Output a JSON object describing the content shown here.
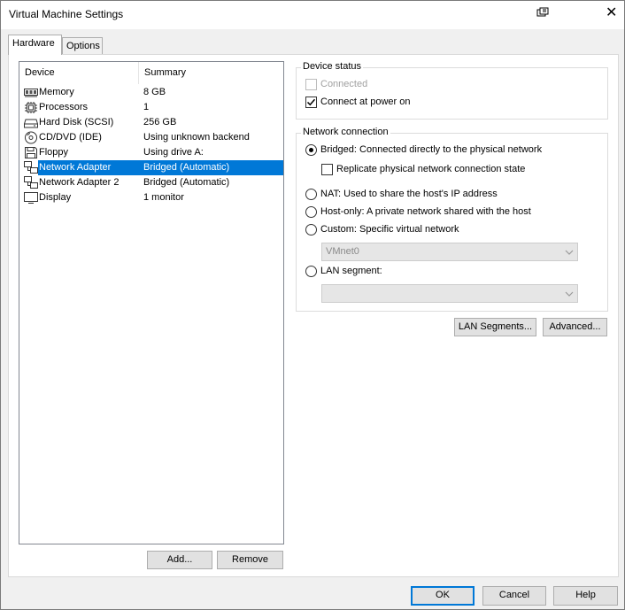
{
  "window": {
    "title": "Virtual Machine Settings"
  },
  "tabs": [
    {
      "label": "Hardware",
      "active": true
    },
    {
      "label": "Options",
      "active": false
    }
  ],
  "device_list": {
    "headers": {
      "device": "Device",
      "summary": "Summary"
    },
    "rows": [
      {
        "device": "Memory",
        "summary": "8 GB",
        "icon": "memory-icon"
      },
      {
        "device": "Processors",
        "summary": "1",
        "icon": "processor-icon"
      },
      {
        "device": "Hard Disk (SCSI)",
        "summary": "256 GB",
        "icon": "hard-disk-icon"
      },
      {
        "device": "CD/DVD (IDE)",
        "summary": "Using unknown backend",
        "icon": "cd-dvd-icon"
      },
      {
        "device": "Floppy",
        "summary": "Using drive A:",
        "icon": "floppy-icon"
      },
      {
        "device": "Network Adapter",
        "summary": "Bridged (Automatic)",
        "icon": "network-adapter-icon",
        "selected": true
      },
      {
        "device": "Network Adapter 2",
        "summary": "Bridged (Automatic)",
        "icon": "network-adapter-icon"
      },
      {
        "device": "Display",
        "summary": "1 monitor",
        "icon": "display-icon"
      }
    ]
  },
  "buttons": {
    "add": "Add...",
    "remove": "Remove",
    "lan_segments": "LAN Segments...",
    "advanced": "Advanced...",
    "ok": "OK",
    "cancel": "Cancel",
    "help": "Help"
  },
  "device_status": {
    "title": "Device status",
    "connected": {
      "label": "Connected",
      "checked": false,
      "enabled": false
    },
    "connect_at_power_on": {
      "label": "Connect at power on",
      "checked": true,
      "enabled": true
    }
  },
  "network_connection": {
    "title": "Network connection",
    "bridged": {
      "label": "Bridged: Connected directly to the physical network",
      "selected": true
    },
    "replicate": {
      "label": "Replicate physical network connection state",
      "checked": false
    },
    "nat": {
      "label": "NAT: Used to share the host's IP address",
      "selected": false
    },
    "host_only": {
      "label": "Host-only: A private network shared with the host",
      "selected": false
    },
    "custom": {
      "label": "Custom: Specific virtual network",
      "selected": false
    },
    "custom_network_value": "VMnet0",
    "lan_segment": {
      "label": "LAN segment:",
      "selected": false
    },
    "lan_segment_value": ""
  },
  "colors": {
    "selection": "#0078d7",
    "accent": "#0078d7"
  }
}
